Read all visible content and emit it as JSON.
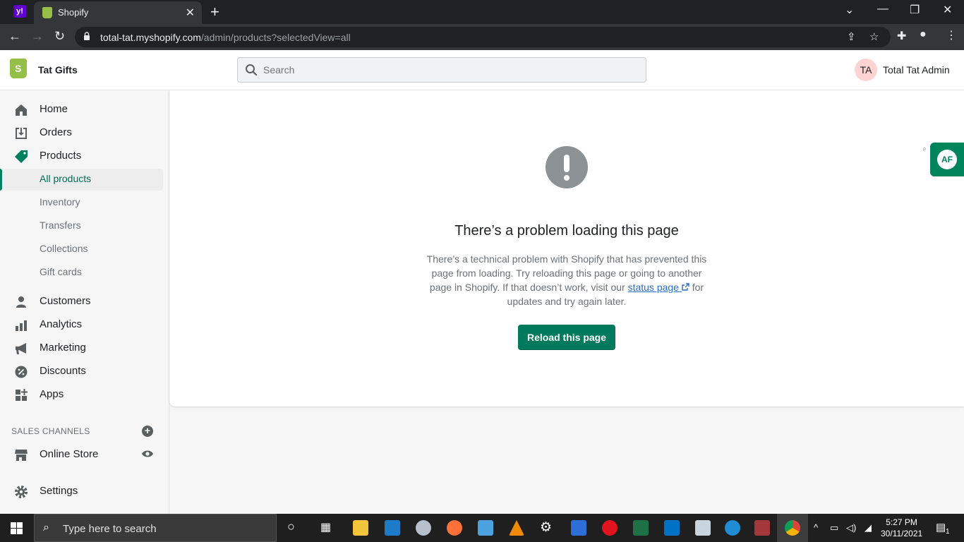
{
  "browser": {
    "tab_title": "Shopify",
    "url_host": "total-tat.myshopify.com",
    "url_path": "/admin/products?selectedView=all"
  },
  "header": {
    "store_name": "Tat Gifts",
    "search_placeholder": "Search",
    "avatar_initials": "TA",
    "user_name": "Total Tat Admin"
  },
  "sidebar": {
    "items": [
      {
        "label": "Home"
      },
      {
        "label": "Orders"
      },
      {
        "label": "Products"
      },
      {
        "label": "All products"
      },
      {
        "label": "Inventory"
      },
      {
        "label": "Transfers"
      },
      {
        "label": "Collections"
      },
      {
        "label": "Gift cards"
      },
      {
        "label": "Customers"
      },
      {
        "label": "Analytics"
      },
      {
        "label": "Marketing"
      },
      {
        "label": "Discounts"
      },
      {
        "label": "Apps"
      }
    ],
    "sales_channels_title": "SALES CHANNELS",
    "online_store": "Online Store",
    "settings": "Settings"
  },
  "main": {
    "error_title": "There’s a problem loading this page",
    "error_text_1": "There’s a technical problem with Shopify that has prevented this page from loading. Try reloading this page or going to another page in Shopify. If that doesn’t work, visit our",
    "status_link": "status page",
    "error_text_2": "for updates and try again later.",
    "reload_button": "Reload this page",
    "widget_label": "AF",
    "tiny_label": "P"
  },
  "taskbar": {
    "search_placeholder": "Type here to search",
    "time": "5:27 PM",
    "date": "30/11/2021",
    "notification_count": "1"
  },
  "colors": {
    "accent": "#008060",
    "button": "#007a5c",
    "link": "#2c6ecb"
  }
}
